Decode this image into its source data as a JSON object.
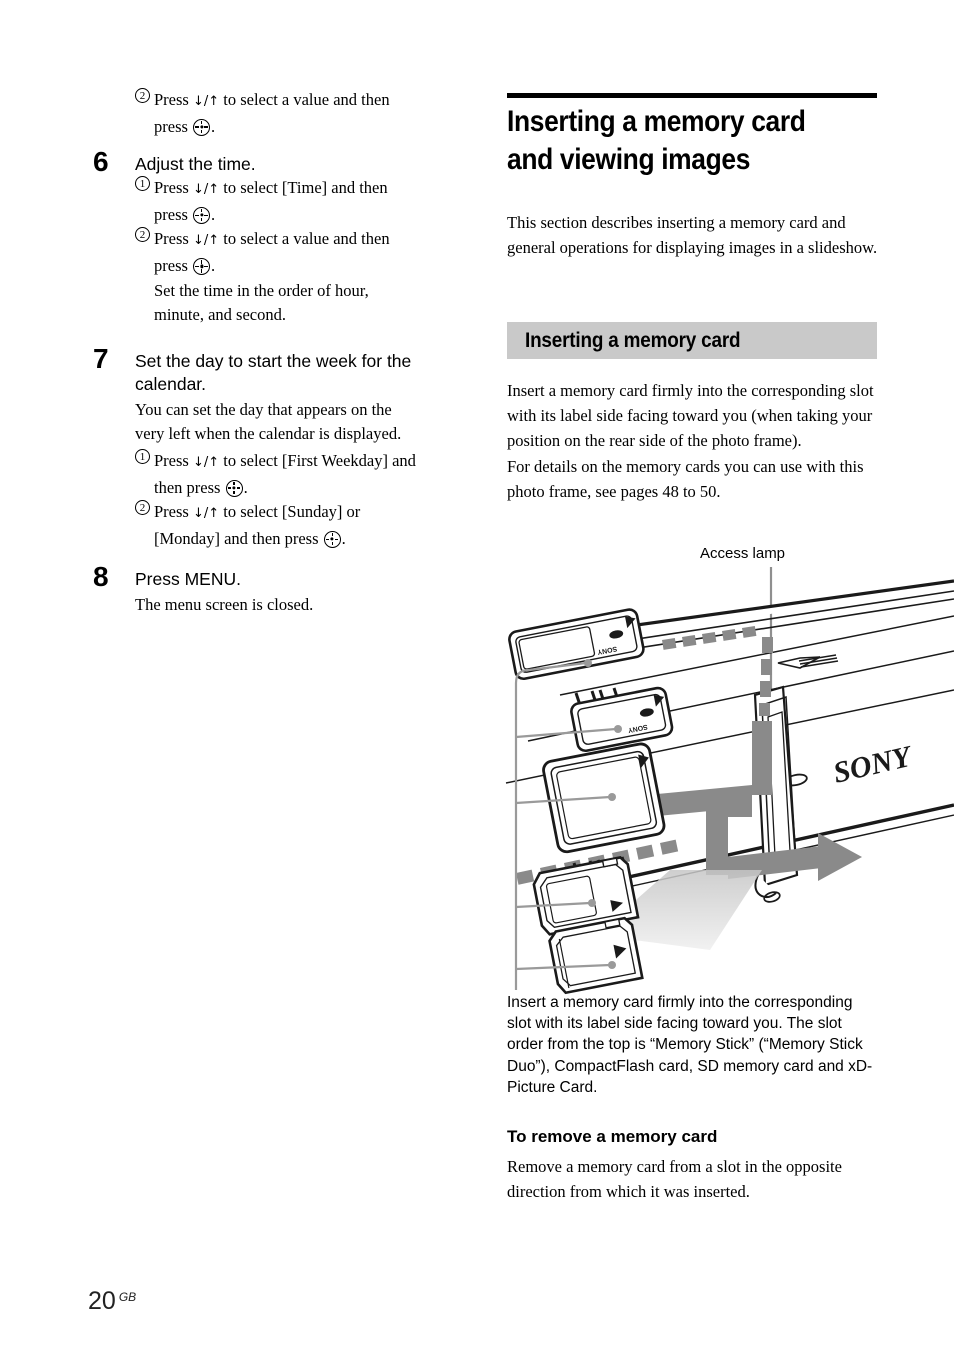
{
  "page": {
    "folio_number": "20",
    "folio_suffix": "GB"
  },
  "left_column": {
    "lead_item": {
      "marker": "2",
      "line1_pre": "Press ",
      "arrows": "↓/↑",
      "line1_post": " to select a value and then",
      "line2_pre": "press ",
      "line2_post": "."
    },
    "steps": [
      {
        "number": "6",
        "title": "Adjust the time.",
        "items": [
          {
            "marker": "1",
            "line1_pre": "Press ",
            "arrows": "↓/↑",
            "line1_post": " to select [Time] and then",
            "line2_pre": "press ",
            "line2_post": "."
          },
          {
            "marker": "2",
            "line1_pre": "Press ",
            "arrows": "↓/↑",
            "line1_post": " to select a value and then",
            "line2_pre": "press ",
            "line2_post": "."
          }
        ],
        "trailing_text_line1": "Set the time in the order of hour,",
        "trailing_text_line2": "minute, and second."
      },
      {
        "number": "7",
        "title": "Set the day to start the week for the calendar.",
        "body_line1": "You can set the day that appears on the",
        "body_line2": "very left when the calendar is displayed.",
        "items": [
          {
            "marker": "1",
            "line1_pre": "Press ",
            "arrows": "↓/↑",
            "line1_post": " to select [First Weekday] and",
            "line2_pre": "then press ",
            "line2_post": "."
          },
          {
            "marker": "2",
            "line1_pre": "Press ",
            "arrows": "↓/↑",
            "line1_post": " to select [Sunday] or",
            "line2_pre": "[Monday] and then press ",
            "line2_post": "."
          }
        ]
      },
      {
        "number": "8",
        "title": "Press MENU.",
        "body_line1": "The menu screen is closed."
      }
    ]
  },
  "right_column": {
    "chapter_title_line1": "Inserting a memory card",
    "chapter_title_line2": "and viewing images",
    "intro": "This section describes inserting a memory card and general operations for displaying images in a slideshow.",
    "section_heading": "Inserting a memory card",
    "section_paragraph_1": "Insert a memory card firmly into the corresponding slot with its label side facing toward you (when taking your position on the rear side of the photo frame).",
    "section_paragraph_2": "For details on the memory cards you can use with this photo frame, see pages 48 to 50.",
    "figure": {
      "callout_label": "Access lamp",
      "brand_mark": "SONY",
      "card_labels": [
        "SONY",
        "SONY"
      ]
    },
    "figure_caption": "Insert a memory card firmly into the corresponding slot with its label side facing toward you. The slot order from the top is “Memory Stick” (“Memory Stick Duo”), CompactFlash card, SD memory card and xD-Picture Card.",
    "sub_heading": "To remove a memory card",
    "sub_heading_body": "Remove a memory card from a slot in the opposite direction from which it was inserted."
  },
  "colors": {
    "rule": "#000000",
    "gray_band": "#c9c9c9",
    "figure_gray": "#8a8a8a",
    "leader_gray": "#9a9a9a"
  }
}
